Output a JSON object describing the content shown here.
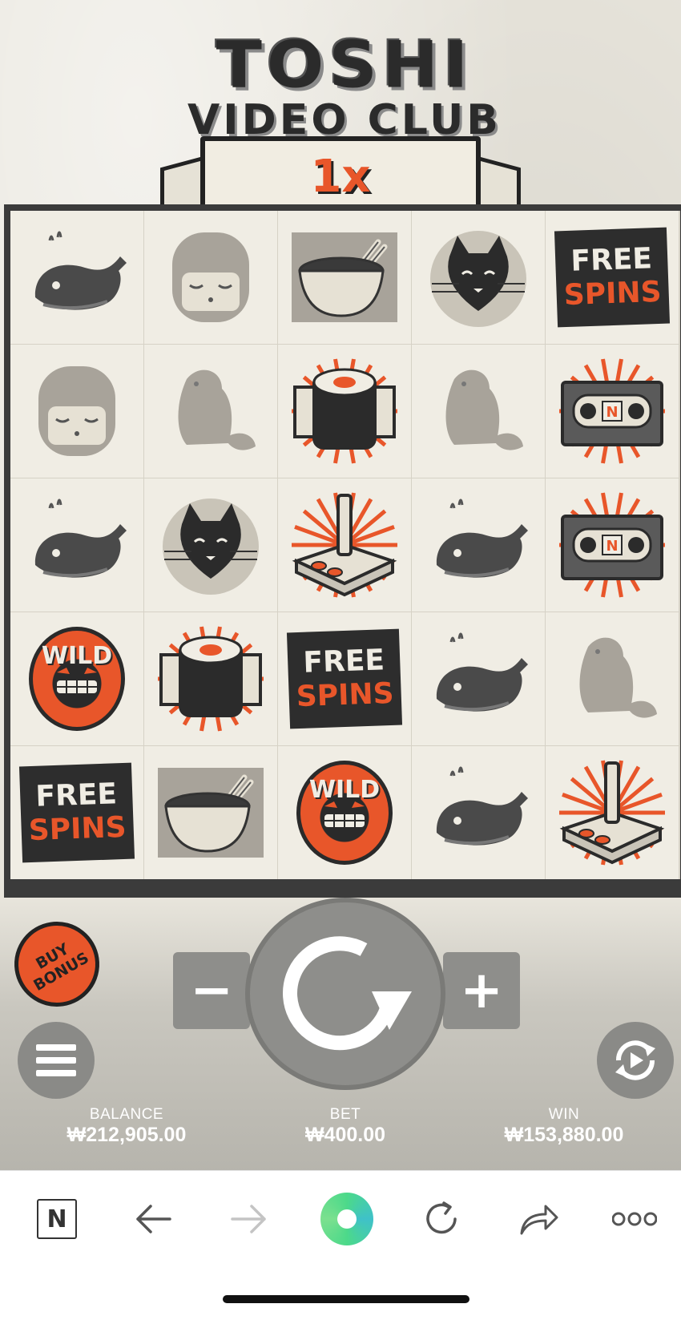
{
  "game": {
    "title_line1": "TOSHI",
    "title_line2": "VIDEO CLUB",
    "multiplier": "1x"
  },
  "reels": {
    "grid": [
      [
        "whale",
        "girl",
        "bowl",
        "cat",
        "free-spins"
      ],
      [
        "girl",
        "beaver",
        "sushi",
        "beaver",
        "vhs"
      ],
      [
        "whale",
        "cat",
        "joystick",
        "whale",
        "vhs"
      ],
      [
        "wild",
        "sushi",
        "free-spins",
        "whale",
        "beaver"
      ],
      [
        "free-spins",
        "bowl",
        "wild",
        "whale",
        "joystick"
      ]
    ],
    "free_spins_line1": "FREE",
    "free_spins_line2": "SPINS",
    "wild_label": "WILD",
    "vhs_label": "N"
  },
  "controls": {
    "buy_bonus_line1": "BUY",
    "buy_bonus_line2": "BONUS",
    "minus_label": "−",
    "plus_label": "+"
  },
  "stats": {
    "balance_label": "BALANCE",
    "balance_value": "₩212,905.00",
    "bet_label": "BET",
    "bet_value": "₩400.00",
    "win_label": "WIN",
    "win_value": "₩153,880.00"
  },
  "browser": {
    "logo_letter": "N"
  },
  "colors": {
    "accent": "#e8562a",
    "dark": "#2d2d2d",
    "paper": "#f0ede4",
    "grey": "#8e8e8b"
  }
}
